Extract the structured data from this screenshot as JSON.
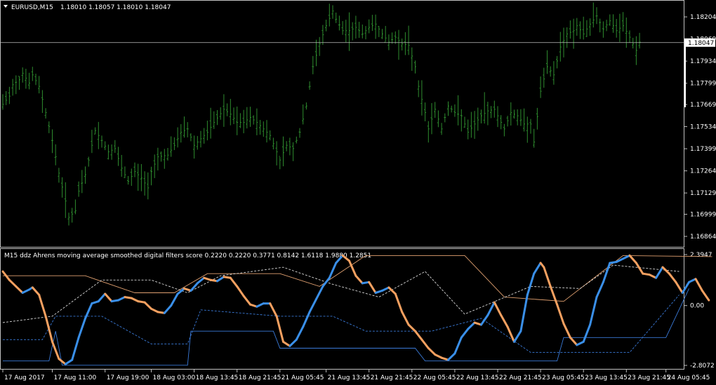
{
  "main_panel": {
    "symbol_label": "EURUSD,M15",
    "ohlc": "1.18010 1.18057 1.18010 1.18047",
    "current_price": "1.18047"
  },
  "indicator_panel": {
    "title": "M15 ddz Ahrens moving average smoothed digital filters score 0.2220 0.2220 0.3771 0.8142 1.6118 1.9880 1.2851"
  },
  "colors": {
    "background": "#000000",
    "frame": "#c0c0c0",
    "candle": "#2e8b2e",
    "price_line": "#c0c0c0",
    "score_up": "#3a8fe8",
    "score_down": "#f4a060",
    "band_blue": "#3a7ad8",
    "band_orange": "#e0a070",
    "band_white": "#d8d8d8"
  },
  "chart_data": [
    {
      "type": "line",
      "series_style": "ohlc-bars",
      "ylim": [
        1.168,
        1.1829
      ],
      "y_ticks": [
        "1.18204",
        "1.18069",
        "1.17934",
        "1.17799",
        "1.17669",
        "1.17534",
        "1.17399",
        "1.17264",
        "1.17129",
        "1.16999",
        "1.16864"
      ],
      "y_tick_values": [
        1.18204,
        1.18069,
        1.17934,
        1.17799,
        1.17669,
        1.17534,
        1.17399,
        1.17264,
        1.17129,
        1.16999,
        1.16864
      ],
      "close_price": 1.18047,
      "price_path": [
        [
          0,
          1.1767
        ],
        [
          2,
          1.1772
        ],
        [
          3,
          1.1779
        ],
        [
          5,
          1.1782
        ],
        [
          6,
          1.1786
        ],
        [
          8,
          1.178
        ],
        [
          9,
          1.1785
        ],
        [
          11,
          1.1778
        ],
        [
          13,
          1.1762
        ],
        [
          15,
          1.1745
        ],
        [
          17,
          1.1725
        ],
        [
          19,
          1.1708
        ],
        [
          20,
          1.1698
        ],
        [
          22,
          1.1702
        ],
        [
          23,
          1.1714
        ],
        [
          25,
          1.1724
        ],
        [
          27,
          1.1742
        ],
        [
          28,
          1.1751
        ],
        [
          30,
          1.1745
        ],
        [
          32,
          1.1738
        ],
        [
          34,
          1.174
        ],
        [
          36,
          1.1728
        ],
        [
          38,
          1.172
        ],
        [
          40,
          1.1726
        ],
        [
          42,
          1.1722
        ],
        [
          44,
          1.1716
        ],
        [
          45,
          1.1726
        ],
        [
          47,
          1.1735
        ],
        [
          50,
          1.1736
        ],
        [
          52,
          1.1742
        ],
        [
          54,
          1.175
        ],
        [
          56,
          1.1752
        ],
        [
          58,
          1.1742
        ],
        [
          60,
          1.1746
        ],
        [
          62,
          1.175
        ],
        [
          64,
          1.1756
        ],
        [
          67,
          1.1764
        ],
        [
          69,
          1.1761
        ],
        [
          71,
          1.1756
        ],
        [
          73,
          1.1756
        ],
        [
          75,
          1.1759
        ],
        [
          77,
          1.1756
        ],
        [
          79,
          1.1752
        ],
        [
          81,
          1.1748
        ],
        [
          83,
          1.1738
        ],
        [
          84,
          1.1733
        ],
        [
          86,
          1.1742
        ],
        [
          88,
          1.174
        ],
        [
          90,
          1.175
        ],
        [
          92,
          1.1766
        ],
        [
          94,
          1.179
        ],
        [
          96,
          1.1804
        ],
        [
          98,
          1.1815
        ],
        [
          100,
          1.1824
        ],
        [
          101,
          1.1819
        ],
        [
          103,
          1.1812
        ],
        [
          105,
          1.1812
        ],
        [
          107,
          1.1814
        ],
        [
          109,
          1.181
        ],
        [
          111,
          1.1814
        ],
        [
          113,
          1.1816
        ],
        [
          115,
          1.181
        ],
        [
          117,
          1.1805
        ],
        [
          119,
          1.1808
        ],
        [
          121,
          1.1804
        ],
        [
          123,
          1.1803
        ],
        [
          125,
          1.179
        ],
        [
          126,
          1.1778
        ],
        [
          128,
          1.1762
        ],
        [
          129,
          1.1752
        ],
        [
          131,
          1.1764
        ],
        [
          133,
          1.1752
        ],
        [
          135,
          1.1766
        ],
        [
          137,
          1.1762
        ],
        [
          139,
          1.176
        ],
        [
          141,
          1.175
        ],
        [
          143,
          1.1755
        ],
        [
          145,
          1.176
        ],
        [
          147,
          1.1763
        ],
        [
          149,
          1.1764
        ],
        [
          150,
          1.176
        ],
        [
          152,
          1.1752
        ],
        [
          154,
          1.1762
        ],
        [
          156,
          1.176
        ],
        [
          158,
          1.1755
        ],
        [
          160,
          1.1755
        ],
        [
          161,
          1.1744
        ],
        [
          163,
          1.1775
        ],
        [
          165,
          1.179
        ],
        [
          167,
          1.1785
        ],
        [
          169,
          1.1802
        ],
        [
          171,
          1.181
        ],
        [
          173,
          1.1812
        ],
        [
          174,
          1.1815
        ],
        [
          176,
          1.181
        ],
        [
          178,
          1.1816
        ],
        [
          180,
          1.1821
        ],
        [
          182,
          1.1813
        ],
        [
          184,
          1.1818
        ],
        [
          186,
          1.1812
        ],
        [
          188,
          1.1815
        ],
        [
          190,
          1.1808
        ],
        [
          192,
          1.18
        ],
        [
          193,
          1.1805
        ]
      ]
    },
    {
      "type": "line",
      "ylim": [
        -2.8072,
        2.3947
      ],
      "y_ticks": [
        "2.3947",
        "0.00",
        "-2.8072"
      ],
      "y_tick_values": [
        2.3947,
        0.0,
        -2.8072
      ],
      "x_ticks": [
        "17 Aug 2017",
        "17 Aug 11:00",
        "17 Aug 19:00",
        "18 Aug 03:00",
        "18 Aug 13:45",
        "18 Aug 21:45",
        "21 Aug 05:45",
        "21 Aug 13:45",
        "21 Aug 21:45",
        "22 Aug 05:45",
        "22 Aug 13:45",
        "22 Aug 21:45",
        "23 Aug 05:45",
        "23 Aug 13:45",
        "23 Aug 21:45",
        "24 Aug 05:45"
      ],
      "x_tick_index": [
        0,
        15,
        31,
        45,
        58,
        71,
        84,
        98,
        111,
        124,
        137,
        150,
        163,
        176,
        189,
        201
      ],
      "score_series": [
        [
          0,
          1.6
        ],
        [
          2,
          1.2
        ],
        [
          4,
          0.9
        ],
        [
          6,
          0.6
        ],
        [
          8,
          0.75
        ],
        [
          9,
          0.85
        ],
        [
          11,
          0.5
        ],
        [
          13,
          -0.5
        ],
        [
          15,
          -1.7
        ],
        [
          17,
          -2.5
        ],
        [
          19,
          -2.75
        ],
        [
          21,
          -2.55
        ],
        [
          23,
          -1.5
        ],
        [
          25,
          -0.6
        ],
        [
          27,
          0.1
        ],
        [
          29,
          0.2
        ],
        [
          31,
          0.55
        ],
        [
          33,
          0.2
        ],
        [
          35,
          0.25
        ],
        [
          37,
          0.4
        ],
        [
          39,
          0.35
        ],
        [
          41,
          0.2
        ],
        [
          43,
          0.15
        ],
        [
          45,
          -0.15
        ],
        [
          47,
          -0.3
        ],
        [
          49,
          -0.35
        ],
        [
          51,
          0.0
        ],
        [
          53,
          0.55
        ],
        [
          55,
          0.8
        ],
        [
          57,
          0.7
        ],
        [
          59,
          1.05
        ],
        [
          61,
          1.3
        ],
        [
          63,
          1.2
        ],
        [
          65,
          1.15
        ],
        [
          67,
          1.35
        ],
        [
          69,
          1.3
        ],
        [
          71,
          0.9
        ],
        [
          73,
          0.45
        ],
        [
          75,
          0.05
        ],
        [
          77,
          -0.05
        ],
        [
          79,
          0.1
        ],
        [
          81,
          0.1
        ],
        [
          83,
          -0.5
        ],
        [
          85,
          -1.7
        ],
        [
          87,
          -1.9
        ],
        [
          89,
          -1.6
        ],
        [
          91,
          -1.0
        ],
        [
          93,
          -0.3
        ],
        [
          95,
          0.3
        ],
        [
          97,
          0.9
        ],
        [
          99,
          1.3
        ],
        [
          101,
          2.0
        ],
        [
          103,
          2.35
        ],
        [
          105,
          2.1
        ],
        [
          107,
          1.4
        ],
        [
          109,
          1.05
        ],
        [
          111,
          1.1
        ],
        [
          113,
          0.6
        ],
        [
          115,
          0.7
        ],
        [
          117,
          0.85
        ],
        [
          119,
          0.55
        ],
        [
          121,
          -0.3
        ],
        [
          123,
          -0.9
        ],
        [
          125,
          -1.2
        ],
        [
          127,
          -1.6
        ],
        [
          129,
          -2.0
        ],
        [
          131,
          -2.3
        ],
        [
          133,
          -2.45
        ],
        [
          135,
          -2.55
        ],
        [
          137,
          -2.25
        ],
        [
          139,
          -1.5
        ],
        [
          141,
          -1.1
        ],
        [
          143,
          -0.8
        ],
        [
          145,
          -0.9
        ],
        [
          147,
          -0.45
        ],
        [
          149,
          0.15
        ],
        [
          151,
          -0.45
        ],
        [
          153,
          -1.0
        ],
        [
          155,
          -1.7
        ],
        [
          157,
          -1.2
        ],
        [
          159,
          0.5
        ],
        [
          161,
          1.5
        ],
        [
          163,
          2.0
        ],
        [
          164,
          1.8
        ],
        [
          166,
          0.9
        ],
        [
          168,
          0.05
        ],
        [
          170,
          -0.85
        ],
        [
          172,
          -1.5
        ],
        [
          174,
          -1.85
        ],
        [
          176,
          -1.7
        ],
        [
          178,
          -0.9
        ],
        [
          180,
          0.4
        ],
        [
          182,
          1.1
        ],
        [
          184,
          2.0
        ],
        [
          186,
          2.05
        ],
        [
          188,
          2.2
        ],
        [
          190,
          2.35
        ],
        [
          192,
          2.0
        ],
        [
          194,
          1.5
        ],
        [
          196,
          1.45
        ],
        [
          198,
          1.3
        ],
        [
          200,
          1.8
        ],
        [
          202,
          1.5
        ],
        [
          204,
          1.1
        ],
        [
          206,
          0.6
        ],
        [
          208,
          1.1
        ],
        [
          210,
          1.25
        ],
        [
          212,
          0.7
        ],
        [
          214,
          0.25
        ]
      ],
      "bands": [
        {
          "color": "blue",
          "style": "solid",
          "points": [
            [
              0,
              -2.6
            ],
            [
              14,
              -2.6
            ],
            [
              16,
              -1.2
            ],
            [
              18,
              -2.8
            ],
            [
              56,
              -2.8
            ],
            [
              57,
              -1.2
            ],
            [
              82,
              -1.2
            ],
            [
              84,
              -2.0
            ],
            [
              125,
              -2.0
            ],
            [
              128,
              -2.6
            ],
            [
              168,
              -2.6
            ],
            [
              170,
              -1.5
            ],
            [
              201,
              -1.5
            ],
            [
              208,
              0.8
            ]
          ]
        },
        {
          "color": "blue",
          "style": "dashed",
          "points": [
            [
              0,
              -1.6
            ],
            [
              12,
              -1.6
            ],
            [
              16,
              -0.5
            ],
            [
              30,
              -0.5
            ],
            [
              45,
              -1.8
            ],
            [
              56,
              -1.8
            ],
            [
              60,
              -0.2
            ],
            [
              84,
              -0.5
            ],
            [
              100,
              -0.5
            ],
            [
              110,
              -1.2
            ],
            [
              130,
              -1.2
            ],
            [
              145,
              -0.6
            ],
            [
              160,
              -2.2
            ],
            [
              190,
              -2.2
            ],
            [
              205,
              0.5
            ]
          ]
        },
        {
          "color": "orange",
          "style": "solid",
          "points": [
            [
              0,
              1.4
            ],
            [
              25,
              1.4
            ],
            [
              40,
              0.6
            ],
            [
              52,
              0.6
            ],
            [
              62,
              1.5
            ],
            [
              84,
              1.5
            ],
            [
              96,
              0.9
            ],
            [
              110,
              2.35
            ],
            [
              140,
              2.35
            ],
            [
              152,
              0.4
            ],
            [
              170,
              0.2
            ],
            [
              188,
              2.35
            ],
            [
              215,
              2.3
            ]
          ]
        },
        {
          "color": "white",
          "style": "dashed",
          "points": [
            [
              0,
              -0.8
            ],
            [
              15,
              -0.5
            ],
            [
              30,
              1.2
            ],
            [
              45,
              1.2
            ],
            [
              56,
              0.6
            ],
            [
              66,
              1.4
            ],
            [
              85,
              1.8
            ],
            [
              100,
              1.0
            ],
            [
              114,
              0.4
            ],
            [
              128,
              1.6
            ],
            [
              140,
              -0.4
            ],
            [
              160,
              0.9
            ],
            [
              175,
              0.8
            ],
            [
              185,
              1.9
            ],
            [
              205,
              1.6
            ]
          ]
        }
      ]
    }
  ]
}
